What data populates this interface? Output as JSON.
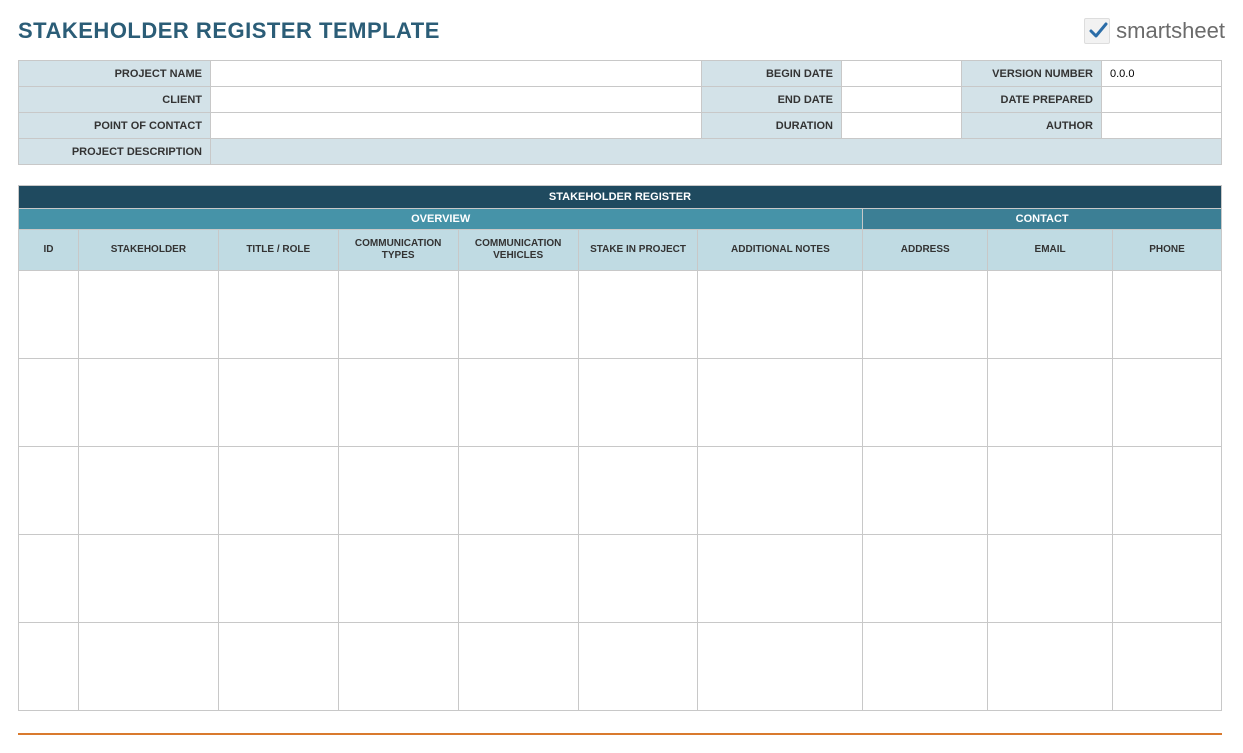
{
  "page": {
    "title": "STAKEHOLDER REGISTER TEMPLATE",
    "logo_text": "smartsheet"
  },
  "meta": {
    "labels": {
      "project_name": "PROJECT NAME",
      "client": "CLIENT",
      "point_of_contact": "POINT OF CONTACT",
      "project_description": "PROJECT DESCRIPTION",
      "begin_date": "BEGIN DATE",
      "end_date": "END DATE",
      "duration": "DURATION",
      "version_number": "VERSION NUMBER",
      "date_prepared": "DATE PREPARED",
      "author": "AUTHOR"
    },
    "values": {
      "project_name": "",
      "client": "",
      "point_of_contact": "",
      "project_description": "",
      "begin_date": "",
      "end_date": "",
      "duration": "",
      "version_number": "0.0.0",
      "date_prepared": "",
      "author": ""
    }
  },
  "register": {
    "title": "STAKEHOLDER REGISTER",
    "groups": {
      "overview": "OVERVIEW",
      "contact": "CONTACT"
    },
    "columns": {
      "id": "ID",
      "stakeholder": "STAKEHOLDER",
      "title_role": "TITLE / ROLE",
      "comm_types": "COMMUNICATION TYPES",
      "comm_vehicles": "COMMUNICATION VEHICLES",
      "stake_in_project": "STAKE IN PROJECT",
      "additional_notes": "ADDITIONAL NOTES",
      "address": "ADDRESS",
      "email": "EMAIL",
      "phone": "PHONE"
    },
    "rows": [
      {
        "id": "",
        "stakeholder": "",
        "title_role": "",
        "comm_types": "",
        "comm_vehicles": "",
        "stake_in_project": "",
        "additional_notes": "",
        "address": "",
        "email": "",
        "phone": ""
      },
      {
        "id": "",
        "stakeholder": "",
        "title_role": "",
        "comm_types": "",
        "comm_vehicles": "",
        "stake_in_project": "",
        "additional_notes": "",
        "address": "",
        "email": "",
        "phone": ""
      },
      {
        "id": "",
        "stakeholder": "",
        "title_role": "",
        "comm_types": "",
        "comm_vehicles": "",
        "stake_in_project": "",
        "additional_notes": "",
        "address": "",
        "email": "",
        "phone": ""
      },
      {
        "id": "",
        "stakeholder": "",
        "title_role": "",
        "comm_types": "",
        "comm_vehicles": "",
        "stake_in_project": "",
        "additional_notes": "",
        "address": "",
        "email": "",
        "phone": ""
      },
      {
        "id": "",
        "stakeholder": "",
        "title_role": "",
        "comm_types": "",
        "comm_vehicles": "",
        "stake_in_project": "",
        "additional_notes": "",
        "address": "",
        "email": "",
        "phone": ""
      }
    ]
  }
}
